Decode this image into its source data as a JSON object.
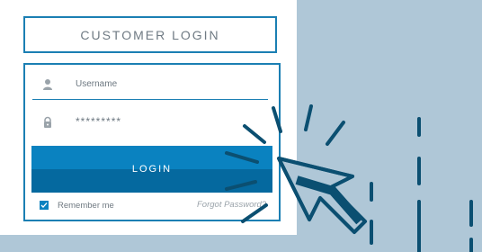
{
  "header": {
    "title": "CUSTOMER LOGIN"
  },
  "form": {
    "username_placeholder": "Username",
    "password_value": "*********",
    "login_label": "LOGIN",
    "remember_label": "Remember me",
    "remember_checked": true,
    "forgot_label": "Forgot Password?"
  },
  "colors": {
    "background": "#afc7d7",
    "accent": "#0a82c0",
    "accent_dark": "#05699f",
    "decoration": "#0b4f71"
  },
  "icons": [
    "user-icon",
    "lock-icon",
    "checkmark-icon",
    "cursor-click-icon"
  ]
}
